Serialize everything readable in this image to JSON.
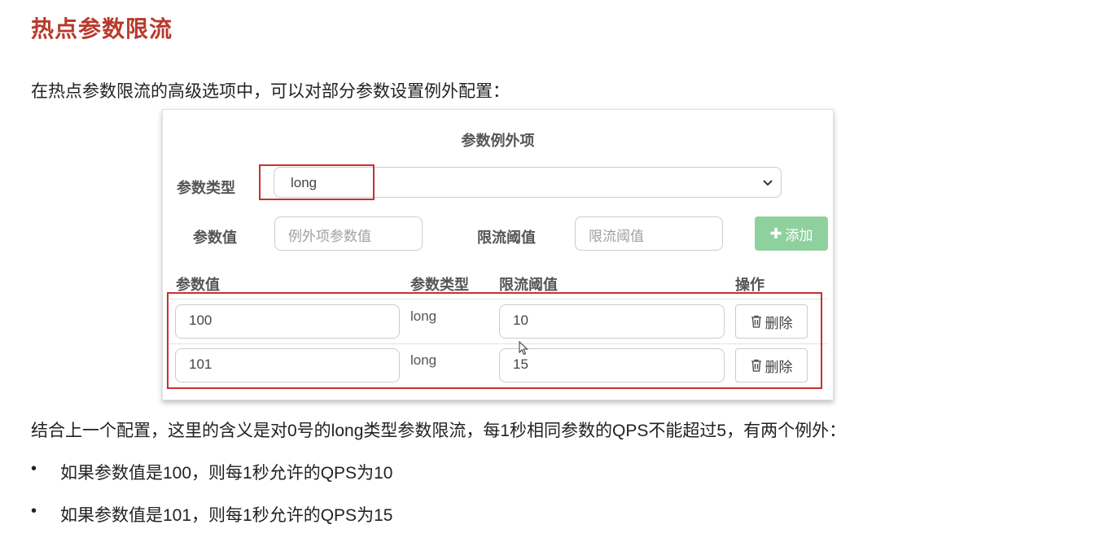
{
  "page_title": "热点参数限流",
  "intro_text": "在热点参数限流的高级选项中，可以对部分参数设置例外配置：",
  "dialog": {
    "title": "参数例外项",
    "param_type_label": "参数类型",
    "param_type_value": "long",
    "param_value_label": "参数值",
    "param_value_placeholder": "例外项参数值",
    "threshold_label": "限流阈值",
    "threshold_placeholder": "限流阈值",
    "add_button_label": "添加",
    "table": {
      "headers": [
        "参数值",
        "参数类型",
        "限流阈值",
        "操作"
      ],
      "rows": [
        {
          "value": "100",
          "type": "long",
          "threshold": "10",
          "action": "删除"
        },
        {
          "value": "101",
          "type": "long",
          "threshold": "15",
          "action": "删除"
        }
      ]
    }
  },
  "summary_text": "结合上一个配置，这里的含义是对0号的long类型参数限流，每1秒相同参数的QPS不能超过5，有两个例外：",
  "bullets": [
    "如果参数值是100，则每1秒允许的QPS为10",
    "如果参数值是101，则每1秒允许的QPS为15"
  ],
  "colors": {
    "title": "#b83a2c",
    "highlight_border": "#c9302c",
    "add_button": "#8fd19e"
  },
  "icons": [
    "chevron-down-icon",
    "plus-icon",
    "trash-icon",
    "mouse-cursor-icon"
  ]
}
